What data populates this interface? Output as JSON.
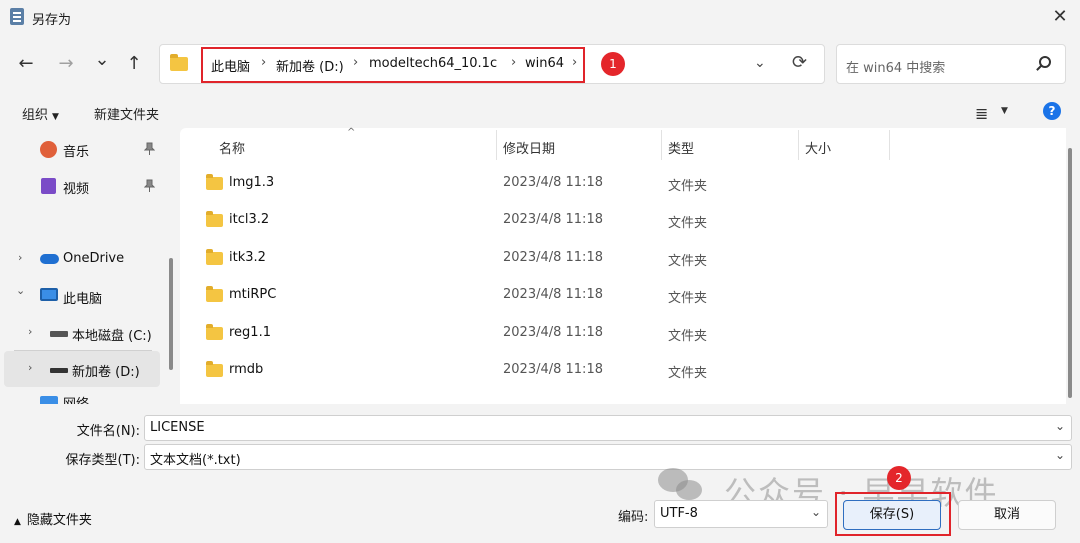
{
  "window": {
    "title": "另存为",
    "close_glyph": "✕"
  },
  "nav": {
    "back_glyph": "←",
    "forward_glyph": "→",
    "recent_glyph": "⌄",
    "up_glyph": "↑",
    "refresh_glyph": "⟳",
    "dropdown_glyph": "⌄"
  },
  "address": {
    "crumbs": [
      "此电脑",
      "新加卷 (D:)",
      "modeltech64_10.1c",
      "win64"
    ],
    "separator": "›",
    "annotation_1": "1"
  },
  "search": {
    "placeholder": "在 win64 中搜索"
  },
  "toolbar": {
    "organize_label": "组织",
    "organize_caret": "▼",
    "new_folder_label": "新建文件夹",
    "view_glyph": "≣",
    "view_caret": "▼",
    "help_glyph": "?"
  },
  "sidebar": {
    "pin_glyph": "📌",
    "chevron_right": "›",
    "chevron_down": "⌄",
    "items": [
      {
        "label": "音乐"
      },
      {
        "label": "视频"
      },
      {
        "label": "OneDrive"
      },
      {
        "label": "此电脑"
      },
      {
        "label": "本地磁盘 (C:)"
      },
      {
        "label": "新加卷 (D:)"
      },
      {
        "label": "网络"
      }
    ]
  },
  "filelist": {
    "sort_glyph": "^",
    "columns": [
      "名称",
      "修改日期",
      "类型",
      "大小"
    ],
    "rows": [
      {
        "name": "lmg1.3",
        "date": "2023/4/8 11:18",
        "type": "文件夹"
      },
      {
        "name": "itcl3.2",
        "date": "2023/4/8 11:18",
        "type": "文件夹"
      },
      {
        "name": "itk3.2",
        "date": "2023/4/8 11:18",
        "type": "文件夹"
      },
      {
        "name": "mtiRPC",
        "date": "2023/4/8 11:18",
        "type": "文件夹"
      },
      {
        "name": "reg1.1",
        "date": "2023/4/8 11:18",
        "type": "文件夹"
      },
      {
        "name": "rmdb",
        "date": "2023/4/8 11:18",
        "type": "文件夹"
      }
    ]
  },
  "form": {
    "filename_label": "文件名(N):",
    "filename_value": "LICENSE",
    "filetype_label": "保存类型(T):",
    "filetype_value": "文本文档(*.txt)",
    "caret_glyph": "⌄"
  },
  "footer": {
    "hide_folders_label": "隐藏文件夹",
    "hide_folders_glyph": "▲",
    "encoding_label": "编码:",
    "encoding_value": "UTF-8",
    "save_label": "保存(S)",
    "cancel_label": "取消",
    "annotation_2": "2"
  },
  "watermark": {
    "text": "公众号 · 早早软件"
  },
  "colors": {
    "accent": "#1a73e8",
    "highlight_red": "#e0242a",
    "folder": "#f4c542"
  }
}
